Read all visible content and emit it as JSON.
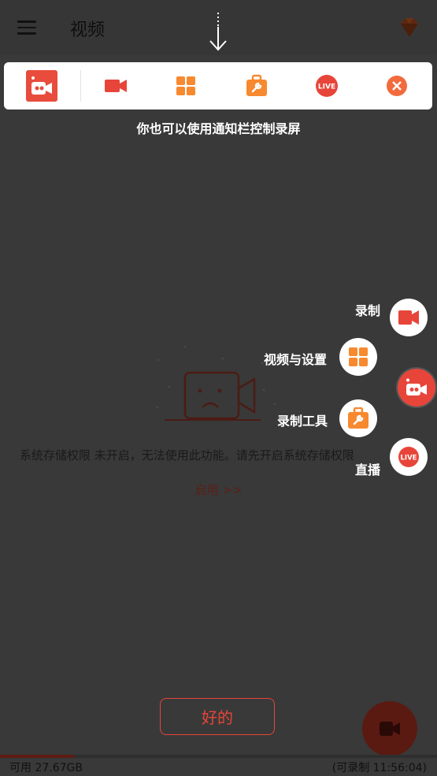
{
  "app": {
    "title": "视频"
  },
  "tutorial": {
    "caption": "你也可以使用通知栏控制录屏",
    "ok_label": "好的"
  },
  "notification_bar": {
    "buttons": [
      "app-icon",
      "record-icon",
      "grid-icon",
      "toolbox-icon",
      "live-icon",
      "close-icon"
    ],
    "live_badge": "LIVE"
  },
  "float_menu": {
    "record_label": "录制",
    "videos_settings_label": "视频与设置",
    "tools_label": "录制工具",
    "live_label": "直播",
    "live_badge": "LIVE"
  },
  "empty_state": {
    "message": "系统存储权限 未开启，无法使用此功能。请先开启系统存储权限",
    "enable_link": "启用 >>"
  },
  "status": {
    "storage_available": "可用 27.67GB",
    "record_time": "(可录制 11:56:04)",
    "storage_used_fraction": 0.17
  },
  "colors": {
    "accent": "#e8453a",
    "orange": "#f7892f",
    "overlay": "#393939"
  }
}
